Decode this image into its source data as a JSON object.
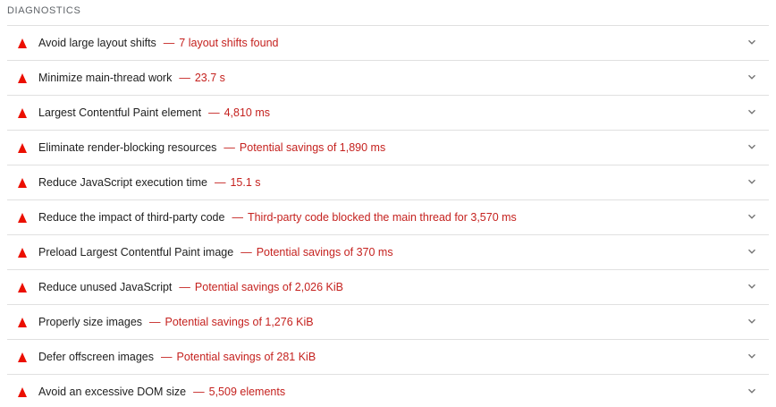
{
  "section": {
    "title": "DIAGNOSTICS"
  },
  "colors": {
    "fail": "#eb0f00",
    "value_text": "#c5221f",
    "header_text": "#5f6368",
    "divider": "#e0e0e0"
  },
  "audits": [
    {
      "title": "Avoid large layout shifts",
      "separator": "—",
      "value": "7 layout shifts found",
      "icon": "fail-triangle-icon"
    },
    {
      "title": "Minimize main-thread work",
      "separator": "—",
      "value": "23.7 s",
      "icon": "fail-triangle-icon"
    },
    {
      "title": "Largest Contentful Paint element",
      "separator": "—",
      "value": "4,810 ms",
      "icon": "fail-triangle-icon"
    },
    {
      "title": "Eliminate render-blocking resources",
      "separator": "—",
      "value": "Potential savings of 1,890 ms",
      "icon": "fail-triangle-icon"
    },
    {
      "title": "Reduce JavaScript execution time",
      "separator": "—",
      "value": "15.1 s",
      "icon": "fail-triangle-icon"
    },
    {
      "title": "Reduce the impact of third-party code",
      "separator": "—",
      "value": "Third-party code blocked the main thread for 3,570 ms",
      "icon": "fail-triangle-icon"
    },
    {
      "title": "Preload Largest Contentful Paint image",
      "separator": "—",
      "value": "Potential savings of 370 ms",
      "icon": "fail-triangle-icon"
    },
    {
      "title": "Reduce unused JavaScript",
      "separator": "—",
      "value": "Potential savings of 2,026 KiB",
      "icon": "fail-triangle-icon"
    },
    {
      "title": "Properly size images",
      "separator": "—",
      "value": "Potential savings of 1,276 KiB",
      "icon": "fail-triangle-icon"
    },
    {
      "title": "Defer offscreen images",
      "separator": "—",
      "value": "Potential savings of 281 KiB",
      "icon": "fail-triangle-icon"
    },
    {
      "title": "Avoid an excessive DOM size",
      "separator": "—",
      "value": "5,509 elements",
      "icon": "fail-triangle-icon"
    }
  ]
}
